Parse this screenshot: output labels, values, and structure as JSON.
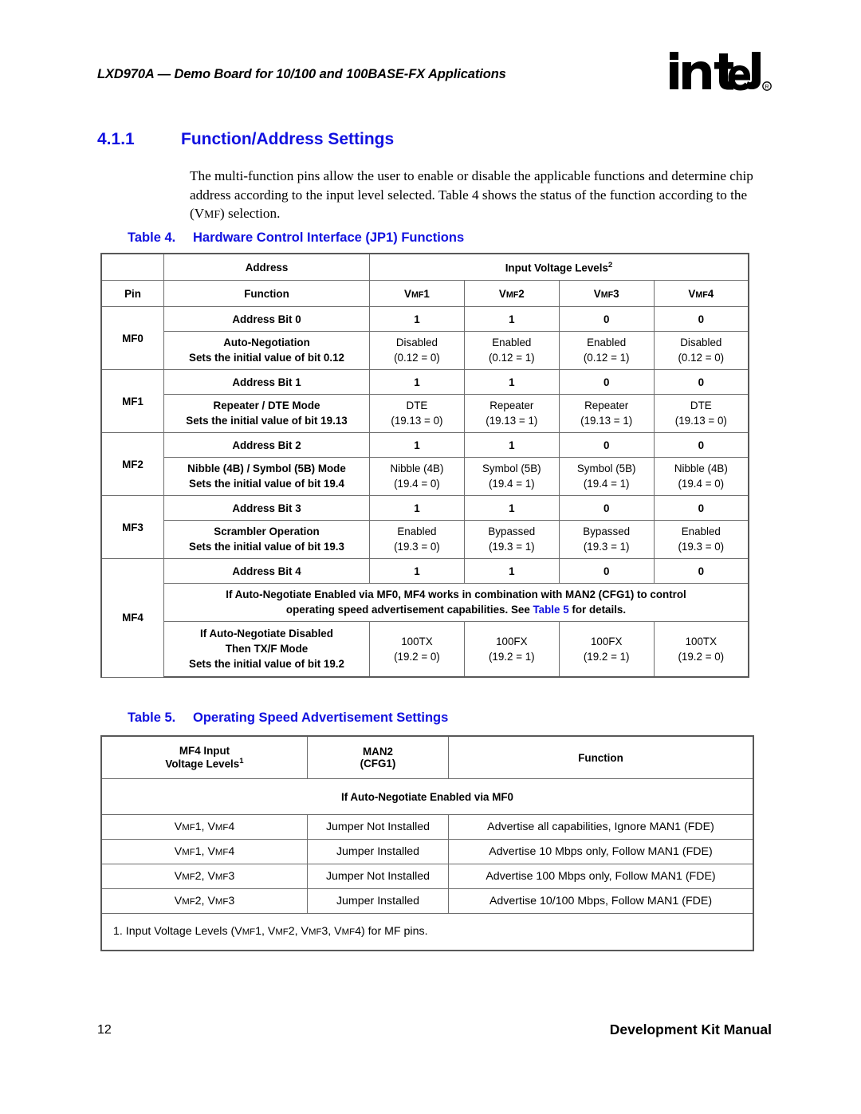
{
  "header": {
    "title": "LXD970A — Demo Board for 10/100 and 100BASE-FX Applications",
    "logo_text": "intel",
    "logo_mark": "®"
  },
  "section": {
    "number": "4.1.1",
    "title": "Function/Address Settings"
  },
  "paragraph": {
    "line1": "The multi-function pins allow the user to enable or disable the applicable functions and determine",
    "line2": "chip address according to the input level selected.  Table 4 shows the status of the function",
    "line3_pre": "according to the (V",
    "line3_sc": "MF",
    "line3_post": ") selection."
  },
  "table4": {
    "caption_label": "Table 4.",
    "caption_title": "Hardware Control Interface (JP1) Functions",
    "header": {
      "address_group": "Address",
      "voltage_group": "Input Voltage Levels",
      "voltage_group_sup": "2",
      "pin": "Pin",
      "function": "Function",
      "v1_pre": "V",
      "v1_sc": "MF",
      "v1_post": "1",
      "v2_pre": "V",
      "v2_sc": "MF",
      "v2_post": "2",
      "v3_pre": "V",
      "v3_sc": "MF",
      "v3_post": "3",
      "v4_pre": "V",
      "v4_sc": "MF",
      "v4_post": "4"
    },
    "rows": [
      {
        "pin": "MF0",
        "addr_label": "Address Bit 0",
        "addr_bits": [
          "1",
          "1",
          "0",
          "0"
        ],
        "func_line1": "Auto-Negotiation",
        "func_line2": "Sets the initial value of bit 0.12",
        "values": [
          {
            "main": "Disabled",
            "note": "(0.12 = 0)"
          },
          {
            "main": "Enabled",
            "note": "(0.12 = 1)"
          },
          {
            "main": "Enabled",
            "note": "(0.12 = 1)"
          },
          {
            "main": "Disabled",
            "note": "(0.12 = 0)"
          }
        ]
      },
      {
        "pin": "MF1",
        "addr_label": "Address Bit 1",
        "addr_bits": [
          "1",
          "1",
          "0",
          "0"
        ],
        "func_line1": "Repeater / DTE Mode",
        "func_line2": "Sets the initial value of bit 19.13",
        "values": [
          {
            "main": "DTE",
            "note": "(19.13 = 0)"
          },
          {
            "main": "Repeater",
            "note": "(19.13 = 1)"
          },
          {
            "main": "Repeater",
            "note": "(19.13 = 1)"
          },
          {
            "main": "DTE",
            "note": "(19.13 = 0)"
          }
        ]
      },
      {
        "pin": "MF2",
        "addr_label": "Address Bit 2",
        "addr_bits": [
          "1",
          "1",
          "0",
          "0"
        ],
        "func_line1": "Nibble (4B) / Symbol (5B) Mode",
        "func_line2": "Sets the initial value of bit 19.4",
        "values": [
          {
            "main": "Nibble (4B)",
            "note": "(19.4 = 0)"
          },
          {
            "main": "Symbol (5B)",
            "note": "(19.4 = 1)"
          },
          {
            "main": "Symbol (5B)",
            "note": "(19.4 = 1)"
          },
          {
            "main": "Nibble (4B)",
            "note": "(19.4 = 0)"
          }
        ]
      },
      {
        "pin": "MF3",
        "addr_label": "Address Bit 3",
        "addr_bits": [
          "1",
          "1",
          "0",
          "0"
        ],
        "func_line1": "Scrambler Operation",
        "func_line2": "Sets the initial value of bit 19.3",
        "values": [
          {
            "main": "Enabled",
            "note": "(19.3 = 0)"
          },
          {
            "main": "Bypassed",
            "note": "(19.3 = 1)"
          },
          {
            "main": "Bypassed",
            "note": "(19.3 = 1)"
          },
          {
            "main": "Enabled",
            "note": "(19.3 = 0)"
          }
        ]
      }
    ],
    "mf4": {
      "pin": "MF4",
      "addr_label": "Address Bit 4",
      "addr_bits": [
        "1",
        "1",
        "0",
        "0"
      ],
      "note_line1": "If Auto-Negotiate Enabled via MF0, MF4 works in combination with MAN2 (CFG1) to control",
      "note_line2_pre": "operating speed advertisement capabilities.  See ",
      "note_line2_link": "Table 5",
      "note_line2_post": " for details.",
      "func_line1": "If Auto-Negotiate Disabled",
      "func_line2": "Then TX/F Mode",
      "func_line3": "Sets the initial value of bit 19.2",
      "values": [
        {
          "main": "100TX",
          "note": "(19.2 = 0)"
        },
        {
          "main": "100FX",
          "note": "(19.2 = 1)"
        },
        {
          "main": "100FX",
          "note": "(19.2 = 1)"
        },
        {
          "main": "100TX",
          "note": "(19.2 = 0)"
        }
      ]
    }
  },
  "table5": {
    "caption_label": "Table 5.",
    "caption_title": "Operating Speed Advertisement Settings",
    "header": {
      "c1_line1": "MF4 Input",
      "c1_line2": "Voltage Levels",
      "c1_sup": "1",
      "c2_line1": "MAN2",
      "c2_line2": "(CFG1)",
      "c3": "Function"
    },
    "banner": "If Auto-Negotiate Enabled via MF0",
    "rows": [
      {
        "levels": [
          "1",
          "4"
        ],
        "jumper": "Jumper Not Installed",
        "function": "Advertise all capabilities,  Ignore MAN1 (FDE)"
      },
      {
        "levels": [
          "1",
          "4"
        ],
        "jumper": "Jumper Installed",
        "function": "Advertise 10 Mbps only,  Follow MAN1 (FDE)"
      },
      {
        "levels": [
          "2",
          "3"
        ],
        "jumper": "Jumper Not Installed",
        "function": "Advertise 100 Mbps only,  Follow MAN1 (FDE)"
      },
      {
        "levels": [
          "2",
          "3"
        ],
        "jumper": "Jumper Installed",
        "function": "Advertise 10/100 Mbps,  Follow MAN1 (FDE)"
      }
    ],
    "footnote": {
      "pre": "1. Input Voltage Levels (V",
      "items": [
        "1",
        "2",
        "3",
        "4"
      ],
      "post": ") for MF pins.",
      "sc": "MF"
    }
  },
  "footer": {
    "page_number": "12",
    "manual_title": "Development Kit Manual"
  },
  "colors": {
    "accent_blue": "#1111E0",
    "text_black": "#000000",
    "table_border": "#6d6d6d"
  }
}
